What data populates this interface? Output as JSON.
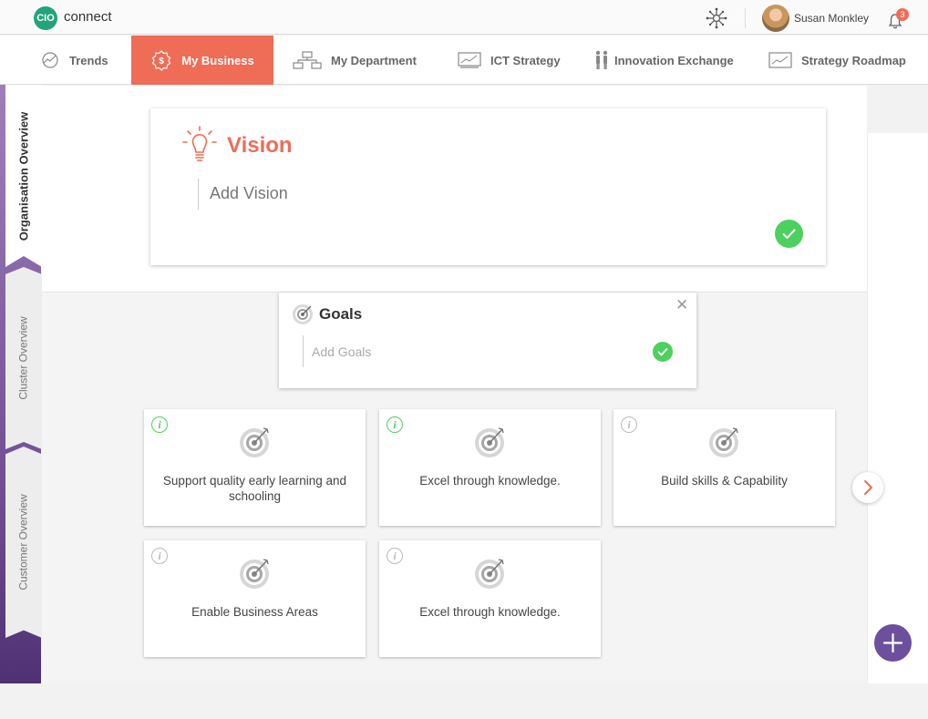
{
  "brand": {
    "logo_badge": "CIO",
    "logo_text": "connect",
    "color": "#23a37c"
  },
  "header": {
    "user_name": "Susan Monkley",
    "notification_count": "3",
    "network_icon": "network-hub-icon",
    "bell_icon": "bell-icon"
  },
  "nav": {
    "accent_color": "#ef6c57",
    "items": [
      {
        "label": "Trends",
        "icon": "trend-chart-icon",
        "active": false
      },
      {
        "label": "My Business",
        "icon": "money-badge-icon",
        "active": true
      },
      {
        "label": "My Department",
        "icon": "org-chart-icon",
        "active": false
      },
      {
        "label": "ICT Strategy",
        "icon": "monitor-chart-icon",
        "active": false
      },
      {
        "label": "Innovation Exchange",
        "icon": "people-icon",
        "active": false
      },
      {
        "label": "Strategy Roadmap",
        "icon": "line-chart-icon",
        "active": false
      }
    ]
  },
  "side_tabs": [
    {
      "label": "Organisation Overview",
      "active": true
    },
    {
      "label": "Cluster Overview",
      "active": false
    },
    {
      "label": "Customer Overview",
      "active": false
    }
  ],
  "vision": {
    "title": "Vision",
    "placeholder": "Add Vision",
    "icon": "lightbulb-icon",
    "confirm_icon": "check-icon"
  },
  "goals": {
    "title": "Goals",
    "placeholder": "Add Goals",
    "icon": "target-icon",
    "close_symbol": "✕",
    "confirm_icon": "check-icon"
  },
  "goal_tiles": [
    {
      "label": "Support quality early learning and schooling",
      "info_active": true
    },
    {
      "label": "Excel through knowledge.",
      "info_active": true
    },
    {
      "label": "Build skills & Capability",
      "info_active": false
    },
    {
      "label": "Enable Business Areas",
      "info_active": false
    },
    {
      "label": "Excel through knowledge.",
      "info_active": false
    }
  ],
  "controls": {
    "next_icon": "chevron-right-icon",
    "add_icon": "plus-icon",
    "fab_color": "#6c4f9d",
    "success_color": "#4cd15f"
  }
}
